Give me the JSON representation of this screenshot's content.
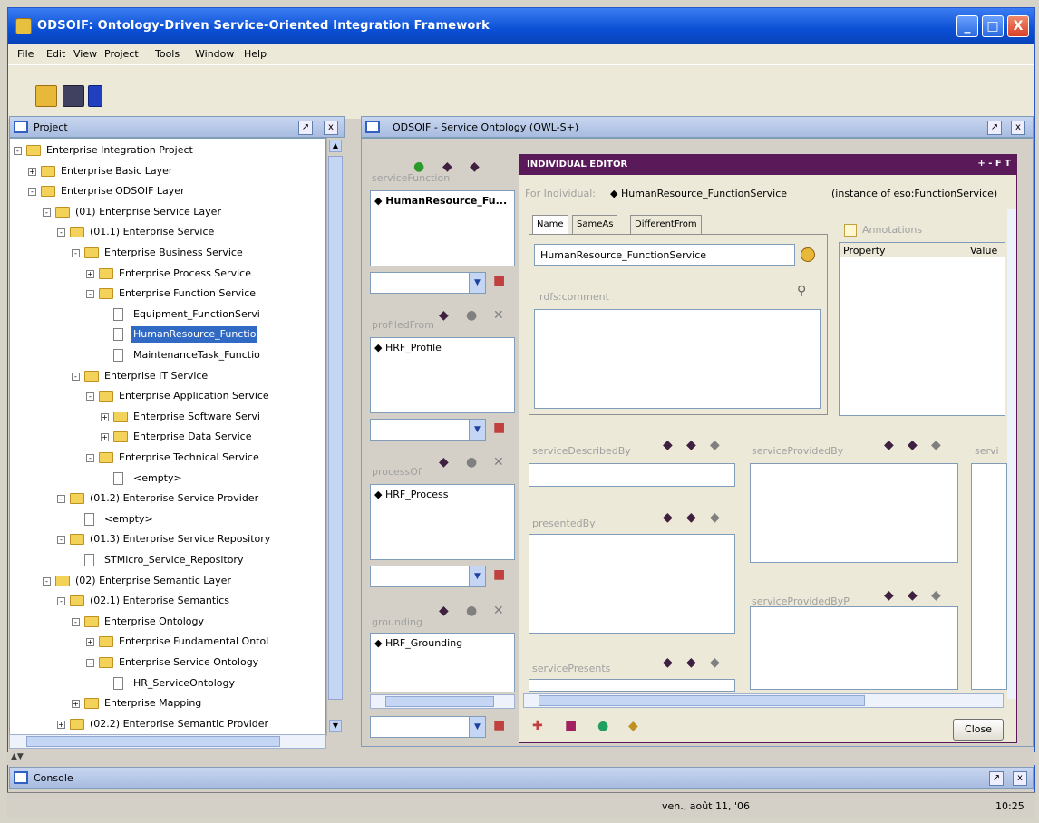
{
  "window": {
    "title": "ODSOIF: Ontology-Driven Service-Oriented Integration Framework",
    "min": "_",
    "max": "□",
    "close": "X"
  },
  "menu": [
    "File",
    "Edit",
    "View",
    "Project",
    "Tools",
    "Window",
    "Help"
  ],
  "project_panel": {
    "title": "Project"
  },
  "tree": [
    {
      "label": "Enterprise Integration Project",
      "depth": 0,
      "expander": "-",
      "icon": "folder-open"
    },
    {
      "label": "Enterprise Basic Layer",
      "depth": 1,
      "expander": "+",
      "icon": "folder"
    },
    {
      "label": "Enterprise ODSOIF Layer",
      "depth": 1,
      "expander": "-",
      "icon": "folder-open"
    },
    {
      "label": "(01) Enterprise Service Layer",
      "depth": 2,
      "expander": "-",
      "icon": "folder-open"
    },
    {
      "label": "(01.1) Enterprise Service",
      "depth": 3,
      "expander": "-",
      "icon": "folder-open"
    },
    {
      "label": "Enterprise Business Service",
      "depth": 4,
      "expander": "-",
      "icon": "folder-open"
    },
    {
      "label": "Enterprise Process Service",
      "depth": 5,
      "expander": "+",
      "icon": "folder"
    },
    {
      "label": "Enterprise Function Service",
      "depth": 5,
      "expander": "-",
      "icon": "folder-open"
    },
    {
      "label": "Equipment_FunctionServi",
      "depth": 6,
      "expander": "",
      "icon": "doc"
    },
    {
      "label": "HumanResource_Functio",
      "depth": 6,
      "expander": "",
      "icon": "doc",
      "selected": true
    },
    {
      "label": "MaintenanceTask_Functio",
      "depth": 6,
      "expander": "",
      "icon": "doc"
    },
    {
      "label": "Enterprise IT Service",
      "depth": 4,
      "expander": "-",
      "icon": "folder-open"
    },
    {
      "label": "Enterprise Application Service",
      "depth": 5,
      "expander": "-",
      "icon": "folder-open"
    },
    {
      "label": "Enterprise Software Servi",
      "depth": 6,
      "expander": "+",
      "icon": "folder"
    },
    {
      "label": "Enterprise Data Service",
      "depth": 6,
      "expander": "+",
      "icon": "folder"
    },
    {
      "label": "Enterprise Technical Service",
      "depth": 5,
      "expander": "-",
      "icon": "folder-open"
    },
    {
      "label": "<empty>",
      "depth": 6,
      "expander": "",
      "icon": "doc"
    },
    {
      "label": "(01.2) Enterprise Service Provider",
      "depth": 3,
      "expander": "-",
      "icon": "folder-open"
    },
    {
      "label": "<empty>",
      "depth": 4,
      "expander": "",
      "icon": "doc"
    },
    {
      "label": "(01.3) Enterprise Service Repository",
      "depth": 3,
      "expander": "-",
      "icon": "folder-open"
    },
    {
      "label": "STMicro_Service_Repository",
      "depth": 4,
      "expander": "",
      "icon": "doc"
    },
    {
      "label": "(02) Enterprise Semantic Layer",
      "depth": 2,
      "expander": "-",
      "icon": "folder-open"
    },
    {
      "label": "(02.1) Enterprise Semantics",
      "depth": 3,
      "expander": "-",
      "icon": "folder-open"
    },
    {
      "label": "Enterprise Ontology",
      "depth": 4,
      "expander": "-",
      "icon": "folder-open"
    },
    {
      "label": "Enterprise Fundamental Ontol",
      "depth": 5,
      "expander": "+",
      "icon": "folder"
    },
    {
      "label": "Enterprise Service Ontology",
      "depth": 5,
      "expander": "-",
      "icon": "folder-open"
    },
    {
      "label": "HR_ServiceOntology",
      "depth": 6,
      "expander": "",
      "icon": "doc"
    },
    {
      "label": "Enterprise Mapping",
      "depth": 4,
      "expander": "+",
      "icon": "folder"
    },
    {
      "label": "(02.2) Enterprise Semantic Provider",
      "depth": 3,
      "expander": "+",
      "icon": "folder"
    }
  ],
  "ontology_panel": {
    "title": "ODSOIF - Service Ontology (OWL-S+)"
  },
  "left_props": [
    {
      "name": "serviceFunction",
      "value": "◆ HumanResource_Fu..."
    },
    {
      "name": "profiledFrom",
      "value": "◆ HRF_Profile"
    },
    {
      "name": "processOf",
      "value": "◆ HRF_Process"
    },
    {
      "name": "grounding",
      "value": "◆ HRF_Grounding"
    }
  ],
  "editor": {
    "title": "INDIVIDUAL EDITOR",
    "title_controls": "+ - F T",
    "for_label": "For Individual:",
    "individual": "◆ HumanResource_FunctionService",
    "instance_of": "(instance of eso:FunctionService)",
    "tabs": [
      "Name",
      "SameAs",
      "DifferentFrom"
    ],
    "name_value": "HumanResource_FunctionService",
    "comment_label": "rdfs:comment",
    "annotations_label": "Annotations",
    "ann_cols": [
      "Property",
      "Value"
    ],
    "props": [
      "serviceDescribedBy",
      "serviceProvidedBy",
      "servi",
      "presentedBy",
      "serviceProvidedByP",
      "servicePresents"
    ],
    "close": "Close"
  },
  "console": {
    "title": "Console"
  },
  "status": {
    "center": "ven., août 11, '06",
    "right": "10:25"
  },
  "colors": {
    "titlebar": "#0a4fd4",
    "editor_bar": "#5a1a5a",
    "selection": "#316ac5"
  }
}
